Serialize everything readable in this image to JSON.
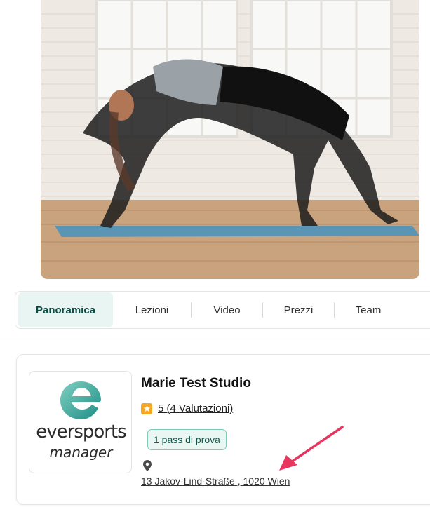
{
  "hero": {
    "image": "woman doing yoga wild-thing pose on blue mat"
  },
  "tabs": [
    {
      "label": "Panoramica",
      "active": true
    },
    {
      "label": "Lezioni",
      "active": false
    },
    {
      "label": "Video",
      "active": false
    },
    {
      "label": "Prezzi",
      "active": false
    },
    {
      "label": "Team",
      "active": false
    }
  ],
  "studio": {
    "logo_word_1": "eversports",
    "logo_word_2": "manager",
    "name": "Marie Test Studio",
    "rating_text": "5 (4 Valutazioni)",
    "badge": "1 pass di prova",
    "address": "13 Jakov-Lind-Straße , 1020 Wien"
  },
  "colors": {
    "accent": "#0d4b45",
    "star": "#f5a623",
    "annotation_arrow": "#e8355f"
  }
}
